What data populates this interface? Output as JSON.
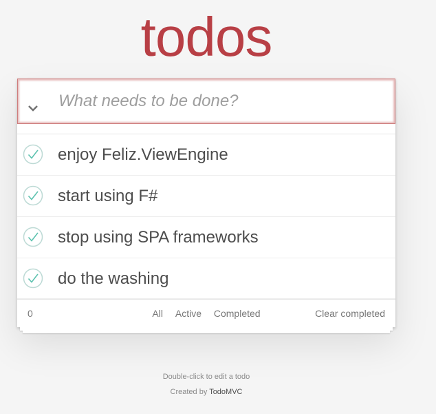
{
  "app": {
    "title": "todos"
  },
  "new_todo": {
    "placeholder": "What needs to be done?",
    "value": "",
    "toggle_all_glyph": "❯"
  },
  "todos": [
    {
      "label": "enjoy Feliz.ViewEngine",
      "completed": true
    },
    {
      "label": "start using F#",
      "completed": true
    },
    {
      "label": "stop using SPA frameworks",
      "completed": true
    },
    {
      "label": "do the washing",
      "completed": true
    }
  ],
  "footer": {
    "count": "0",
    "filters": [
      "All",
      "Active",
      "Completed"
    ],
    "clear_completed": "Clear completed"
  },
  "info": {
    "hint": "Double-click to edit a todo",
    "created_by_prefix": "Created by",
    "created_by_link": "TodoMVC"
  },
  "colors": {
    "title": "#b83f45",
    "check": "#5dc2af",
    "input_border": "#cf7d7d"
  }
}
